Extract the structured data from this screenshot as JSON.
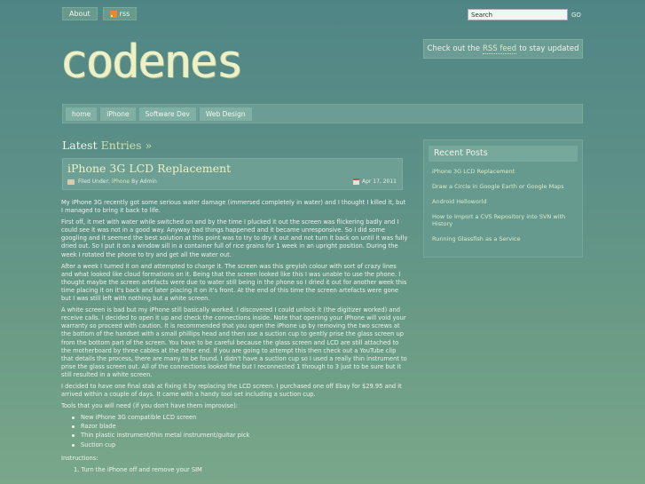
{
  "topnav": {
    "about": "About",
    "rss": "rss"
  },
  "search": {
    "value": "Search",
    "go": "GO"
  },
  "logo": "codenes",
  "rss_box": {
    "prefix": "Check out the",
    "link": "RSS feed",
    "suffix": "to stay updated"
  },
  "mainnav": [
    "home",
    "iPhone",
    "Software Dev",
    "Web Design"
  ],
  "latest": {
    "label": "Latest",
    "accent": "Entries »"
  },
  "post": {
    "title": "iPhone 3G LCD Replacement",
    "filed_under": "Filed Under:",
    "category": "iPhone",
    "by": "By Admin",
    "date": "Apr 17, 2011",
    "paragraphs": [
      "My iPhone 3G recently got some serious water damage (immersed completely in water) and I thought I killed it, but I managed to bring it back to life.",
      "First off, it met with water while switched on and by the time I plucked it out the screen was flickering badly and I could see it was not in a good way. Anyway bad things happened and it became unresponsive. So I did some googling and it seemed the best solution at this point was to try to dry it out and not turn it back on until it was fully dried out. So I put it on a window sill in a container full of rice grains for 1 week in an upright position. During the week I rotated the phone to try and get all the water out.",
      "After a week I turned it on and attempted to charge it. The screen was this greyish colour with sort of crazy lines and what looked like cloud formations on it. Being that the screen looked like this I was unable to use the phone. I thought maybe the screen artefacts were due to water still being in the phone so I dried it out for another week this time placing it on it's back and later placing it on it's front. At the end of this time the screen artefacts were gone but I was still left with nothing but a white screen.",
      "A white screen is bad but my iPhone still basically worked. I discovered I could unlock it (the digitizer worked) and receive calls. I decided to open it up and check the connections inside. Note that opening your iPhone will void your warranty so proceed with caution. It is recommended that you open the iPhone up by removing the two screws at the bottom of the handset with a small phillips head and then use a suction cup to gently prise the glass screen up from the bottom part of the screen. You have to be careful because the glass screen and LCD are still attached to the motherboard by three cables at the other end. If you are going to attempt this then check out a YouTube clip that details the process, there are many to be found. I didn't have a suction cup so I used a really thin instrument to prise the glass screen out. All of the connections looked fine but I reconnected 1 through to 3 just to be sure but it still resulted in a white screen.",
      "I decided to have one final stab at fixing it by replacing the LCD screen. I purchased one off Ebay for $29.95 and it arrived within a couple of days. It came with a handy tool set including a suction cup.",
      "Tools that you will need (if you don't have them improvise):"
    ],
    "tools": [
      "New iPhone 3G compatible LCD screen",
      "Razor blade",
      "Thin plastic instrument/thin metal instrument/guitar pick",
      "Suction cup"
    ],
    "instructions_label": "Instructions:",
    "instructions": [
      "1.  Turn the iPhone off and remove your SIM"
    ]
  },
  "sidebar": {
    "title": "Recent Posts",
    "items": [
      "iPhone 3G LCD Replacement",
      "Draw a Circle in Google Earth or Google Maps",
      "Android Helloworld",
      "How to Import a CVS Repository into SVN with History",
      "Running Glassfish as a Service"
    ]
  }
}
